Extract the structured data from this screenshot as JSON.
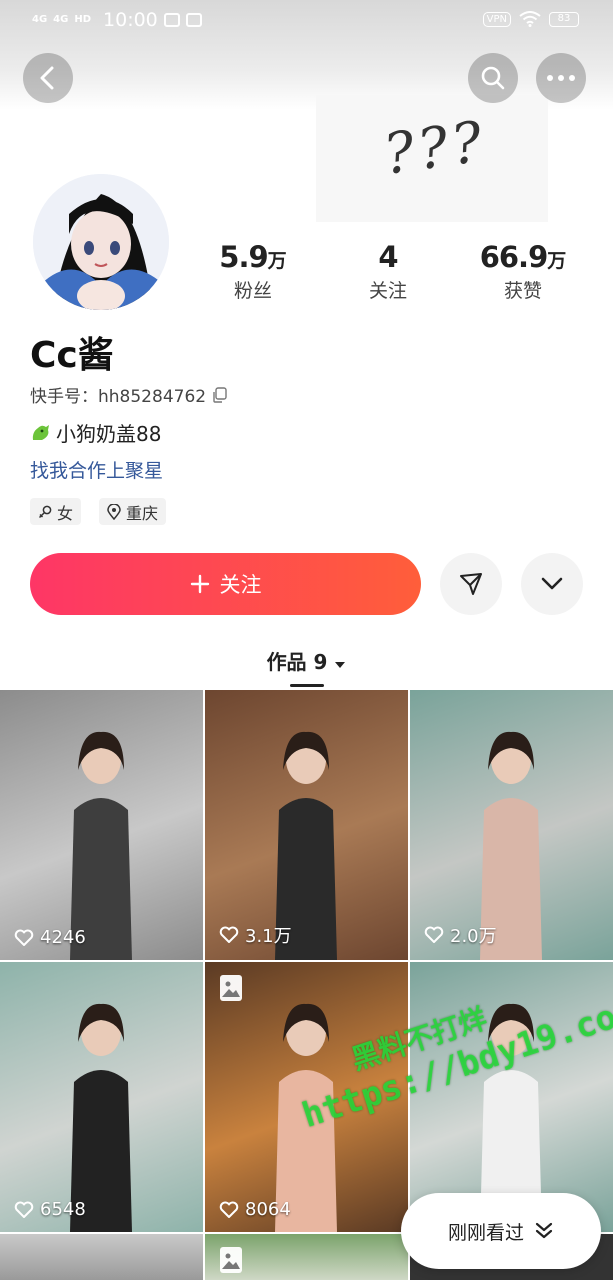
{
  "status_bar": {
    "signal_1": "4G",
    "signal_2": "4G",
    "hd": "HD",
    "time": "10:00",
    "vpn": "VPN",
    "battery": "83"
  },
  "banner": {
    "doodle_text": "???"
  },
  "profile": {
    "nickname": "Cc酱",
    "kwai_id_label": "快手号：",
    "kwai_id": "hh85284762",
    "bio": "小狗奶盖88",
    "coop_link": "找我合作上聚星",
    "gender_tag": "女",
    "location_tag": "重庆"
  },
  "stats": [
    {
      "value": "5.9",
      "unit": "万",
      "label": "粉丝"
    },
    {
      "value": "4",
      "unit": "",
      "label": "关注"
    },
    {
      "value": "66.9",
      "unit": "万",
      "label": "获赞"
    }
  ],
  "actions": {
    "follow_label": "关注"
  },
  "works_tab": {
    "label": "作品 9"
  },
  "grid": [
    {
      "likes": "4246",
      "is_image_post": false,
      "palette": [
        "#8c8c8c",
        "#c8c8c8",
        "#3e3e3e"
      ]
    },
    {
      "likes": "3.1万",
      "is_image_post": false,
      "palette": [
        "#6d4630",
        "#a97a55",
        "#2a2a2a"
      ]
    },
    {
      "likes": "2.0万",
      "is_image_post": false,
      "palette": [
        "#7aa39a",
        "#c4c7c4",
        "#d9b6a8"
      ]
    },
    {
      "likes": "6548",
      "is_image_post": false,
      "palette": [
        "#8eb3aa",
        "#d0d4d1",
        "#222222"
      ]
    },
    {
      "likes": "8064",
      "is_image_post": true,
      "palette": [
        "#5a3a24",
        "#c9823e",
        "#e8b6a0"
      ]
    },
    {
      "likes": "",
      "is_image_post": false,
      "palette": [
        "#7aa39a",
        "#d4d8d5",
        "#f0f0f0"
      ]
    }
  ],
  "recent_pill": {
    "label": "刚刚看过"
  },
  "watermark": {
    "line1": "黑料不打烊",
    "line2": "https://bdy19.co"
  }
}
